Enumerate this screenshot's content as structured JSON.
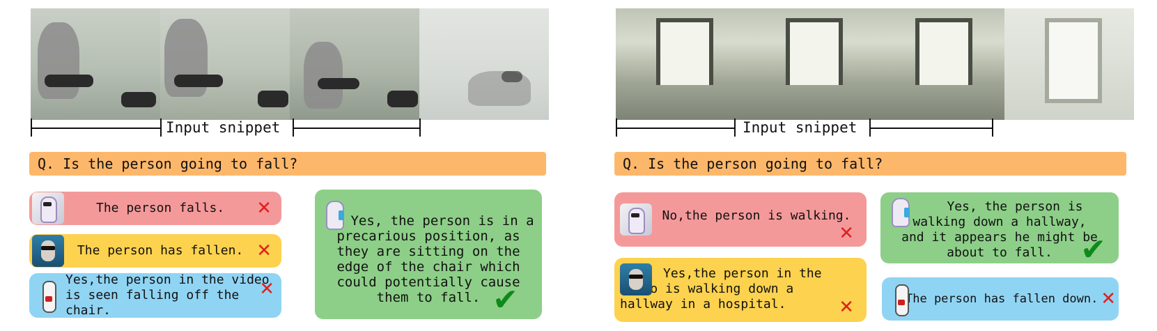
{
  "panels": [
    {
      "snippet_label": "Input snippet",
      "question": "Q. Is the person going to fall?",
      "answers": [
        {
          "text": "The person falls.",
          "verdict": "✕",
          "avatar_icon": "llama-with-film-icon"
        },
        {
          "text": "The person has fallen.",
          "verdict": "✕",
          "avatar_icon": "llama-sunglasses-icon"
        },
        {
          "text": "Yes,the person in the video is seen falling off the chair.",
          "verdict": "✕",
          "avatar_icon": "rabbit-icon"
        },
        {
          "text": "Yes, the person is in a precarious position, as they are sitting on the edge of the chair which could potentially cause them to fall.",
          "verdict": "✔",
          "avatar_icon": "llama-phone-icon"
        }
      ]
    },
    {
      "snippet_label": "Input snippet",
      "question": "Q. Is the person going to fall?",
      "answers": [
        {
          "text": "No,the person is walking.",
          "verdict": "✕",
          "avatar_icon": "llama-with-film-icon"
        },
        {
          "text": "Yes,the person in the video is walking down a hallway in a hospital.",
          "verdict": "✕",
          "avatar_icon": "llama-sunglasses-icon"
        },
        {
          "text": "Yes, the person is walking down a hallway, and it appears he might be about to fall.",
          "verdict": "✔",
          "avatar_icon": "llama-phone-icon"
        },
        {
          "text": "The person has fallen down.",
          "verdict": "✕",
          "avatar_icon": "rabbit-icon"
        }
      ]
    }
  ],
  "colors": {
    "question_bg": "#fdb76a",
    "wrong_red": "#f4999a",
    "wrong_yellow": "#fcd24e",
    "wrong_blue": "#90d4f3",
    "correct_green": "#8dcf88",
    "cross": "#e0201c",
    "check": "#0e8a1b"
  }
}
